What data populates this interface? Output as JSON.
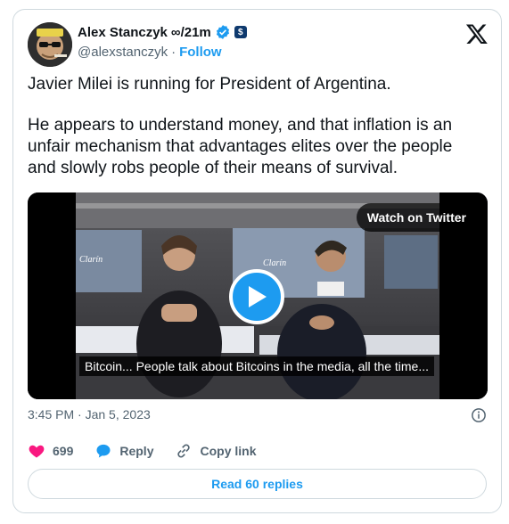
{
  "author": {
    "name": "Alex Stanczyk",
    "name_suffix": "∞/21m",
    "handle": "@alexstanczyk",
    "separator": "·",
    "follow_label": "Follow"
  },
  "tweet": {
    "paragraph1": "Javier Milei is running for President of Argentina.",
    "paragraph2": "He appears to understand money, and that inflation is an unfair mechanism that advantages elites over the people and slowly robs people of their means of survival."
  },
  "media": {
    "watch_label": "Watch on Twitter",
    "caption": "Bitcoin... People talk about Bitcoins in the media, all the time...",
    "logo_text_left": "Clarín",
    "logo_text_right": "Clarín"
  },
  "meta": {
    "time": "3:45 PM",
    "separator": "·",
    "date": "Jan 5, 2023"
  },
  "actions": {
    "likes": "699",
    "reply_label": "Reply",
    "copy_label": "Copy link"
  },
  "footer": {
    "read_replies_label": "Read 60 replies"
  },
  "colors": {
    "accent": "#1d9bf0",
    "like": "#f91880",
    "muted": "#536471",
    "border": "#cfd9de"
  }
}
